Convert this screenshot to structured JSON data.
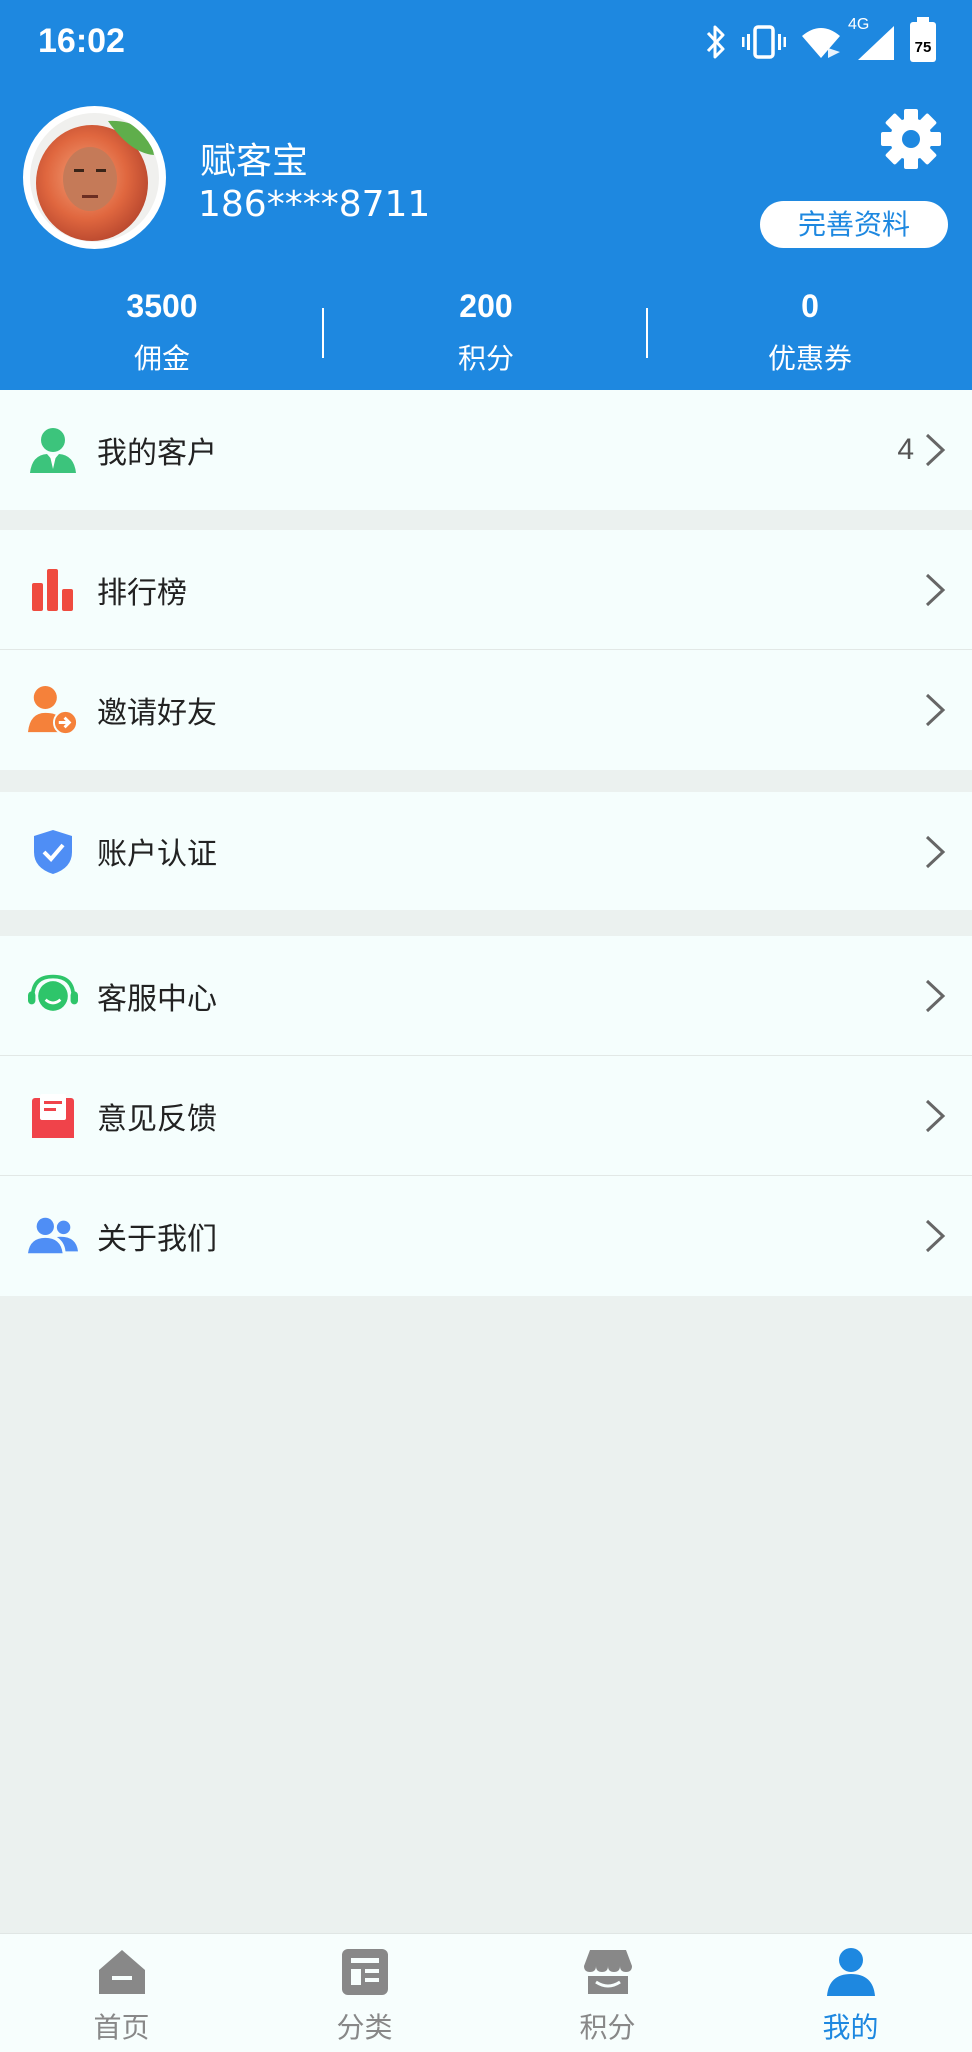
{
  "status_bar": {
    "time": "16:02",
    "network": "4G",
    "battery": "75"
  },
  "profile": {
    "name": "赋客宝",
    "phone": "186****8711",
    "complete_label": "完善资料"
  },
  "stats": [
    {
      "value": "3500",
      "label": "佣金"
    },
    {
      "value": "200",
      "label": "积分"
    },
    {
      "value": "0",
      "label": "优惠券"
    }
  ],
  "menu": {
    "customers": {
      "label": "我的客户",
      "count": "4",
      "icon": "customer-icon",
      "color": "#3cc47c"
    },
    "ranking": {
      "label": "排行榜",
      "icon": "bar-chart-icon",
      "color": "#ef4b3f"
    },
    "invite": {
      "label": "邀请好友",
      "icon": "invite-icon",
      "color": "#f5813a"
    },
    "verify": {
      "label": "账户认证",
      "icon": "shield-check-icon",
      "color": "#4f8ef5"
    },
    "support": {
      "label": "客服中心",
      "icon": "headset-icon",
      "color": "#2ec56a"
    },
    "feedback": {
      "label": "意见反馈",
      "icon": "mail-icon",
      "color": "#f0434a"
    },
    "about": {
      "label": "关于我们",
      "icon": "group-icon",
      "color": "#4f8ef5"
    }
  },
  "tabbar": [
    {
      "label": "首页",
      "icon": "home-icon"
    },
    {
      "label": "分类",
      "icon": "category-icon"
    },
    {
      "label": "积分",
      "icon": "store-icon"
    },
    {
      "label": "我的",
      "icon": "user-icon",
      "active": true
    }
  ],
  "colors": {
    "primary": "#1e88e0",
    "background": "#ebf1ef",
    "card": "#f5fefd"
  }
}
